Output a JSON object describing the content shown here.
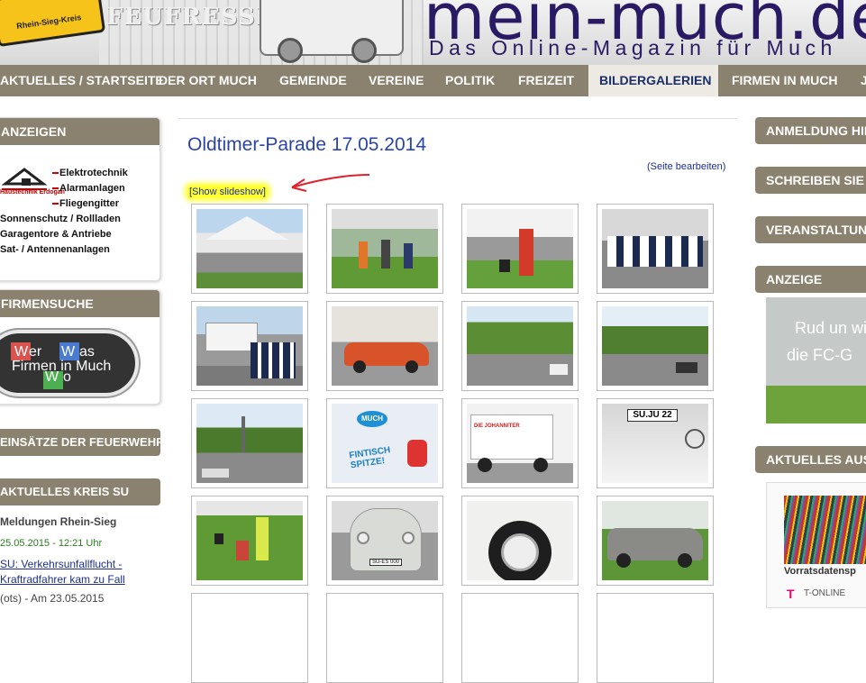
{
  "header": {
    "sign_text": "Rhein-Sieg-Kreis",
    "banner_word": "FEUFRESSER",
    "site_title": "mein-much.de",
    "site_subtitle": "Das Online-Magazin für Much"
  },
  "nav": {
    "items": [
      {
        "label": "Aktuelles / Startseite"
      },
      {
        "label": "Der Ort Much"
      },
      {
        "label": "Gemeinde"
      },
      {
        "label": "Vereine"
      },
      {
        "label": "Politik"
      },
      {
        "label": "Freizeit"
      },
      {
        "label": "Bildergalerien"
      },
      {
        "label": "Firmen in Much"
      },
      {
        "label": "J"
      }
    ]
  },
  "left": {
    "anzeigen_head": "Anzeigen",
    "ad_brand": "Haustechnik Erdogan",
    "ad_lines": [
      "Elektrotechnik",
      "Alarmanlagen",
      "Fliegengitter",
      "Sonnenschutz / Rollladen",
      "Garagentore & Antriebe",
      "Sat- / Antennenanlagen"
    ],
    "firmensuche_head": "Firmensuche",
    "wer_was_text": "Firmen in Much",
    "wer_letters": [
      "W",
      "er",
      "W",
      "as",
      "W",
      "o"
    ],
    "feuerwehr_head": "Einsätze der Feuerwehr",
    "kreis_head": "Aktuelles Kreis SU",
    "news_source": "Meldungen Rhein-Sieg",
    "news_date": "25.05.2015 - 12:21 Uhr",
    "news_title": "SU: Verkehrsunfallflucht - Kraftradfahrer kam zu Fall",
    "news_snippet": "(ots) - Am 23.05.2015"
  },
  "main": {
    "title": "Oldtimer-Parade 17.05.2014",
    "edit_link": "(Seite bearbeiten)",
    "slideshow_link": "[Show slideshow]",
    "thumbs": [
      {
        "name": "tent"
      },
      {
        "name": "crowd"
      },
      {
        "name": "man-red"
      },
      {
        "name": "seated-group"
      },
      {
        "name": "truck-group"
      },
      {
        "name": "orange-car"
      },
      {
        "name": "street-trees"
      },
      {
        "name": "street-cars"
      },
      {
        "name": "church-street"
      },
      {
        "name": "much-shirt"
      },
      {
        "name": "johanniter-truck"
      },
      {
        "name": "plate"
      },
      {
        "name": "meadow-people"
      },
      {
        "name": "beetle-front"
      },
      {
        "name": "wheel"
      },
      {
        "name": "mercedes"
      }
    ],
    "plate_text": "SU.JU 22",
    "shirt_text": "MUCH",
    "shirt_word": "FINTISCH SPITZE!",
    "truck_text": "DIE JOHANNITER",
    "beetle_plate": "SU-ES 000"
  },
  "right": {
    "anmeldung": "Anmeldung Hier",
    "schreiben": "Schreiben Sie",
    "veranstaltungen": "Veranstaltungen",
    "anzeige": "Anzeige",
    "ad_line1": "Rud un wi",
    "ad_line2": "die FC-G",
    "aktuelles": "Aktuelles aus",
    "news_caption": "Vorratsdatensp",
    "tonline": "T-ONLINE",
    "tlogo": "T"
  },
  "colors": {
    "nav_bg": "#8a826e",
    "title_blue": "#2a45a6",
    "link_blue": "#1c2e8b",
    "highlight": "#ffff33"
  }
}
